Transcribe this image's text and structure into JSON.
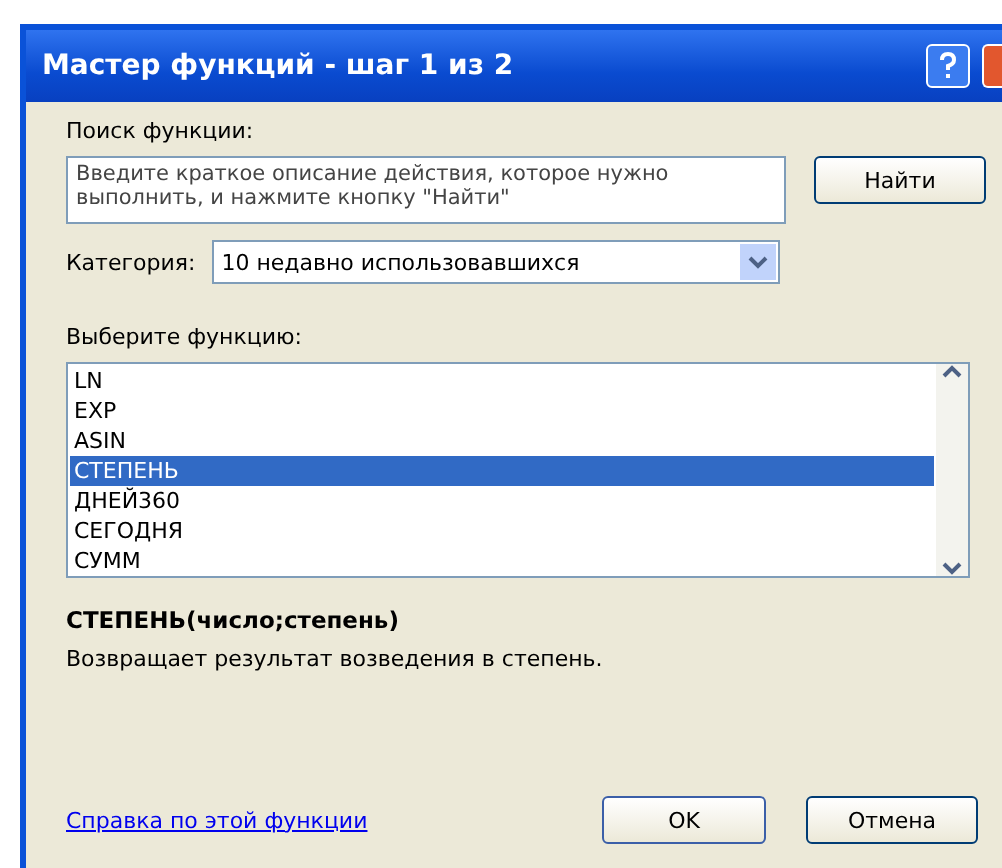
{
  "window": {
    "title": "Мастер функций - шаг 1 из 2"
  },
  "search": {
    "label": "Поиск функции:",
    "placeholder": "Введите краткое описание действия, которое нужно выполнить, и нажмите кнопку \"Найти\"",
    "button": "Найти"
  },
  "category": {
    "label": "Категория:",
    "value": "10 недавно использовавшихся"
  },
  "functions": {
    "label": "Выберите функцию:",
    "items": [
      {
        "name": "LN",
        "selected": false
      },
      {
        "name": "EXP",
        "selected": false
      },
      {
        "name": "ASIN",
        "selected": false
      },
      {
        "name": "СТЕПЕНЬ",
        "selected": true
      },
      {
        "name": "ДНЕЙ360",
        "selected": false
      },
      {
        "name": "СЕГОДНЯ",
        "selected": false
      },
      {
        "name": "СУММ",
        "selected": false
      }
    ]
  },
  "signature": "СТЕПЕНЬ(число;степень)",
  "description": "Возвращает результат возведения в степень.",
  "help_link": "Справка по этой функции",
  "buttons": [
    "OK",
    "Отмена"
  ]
}
